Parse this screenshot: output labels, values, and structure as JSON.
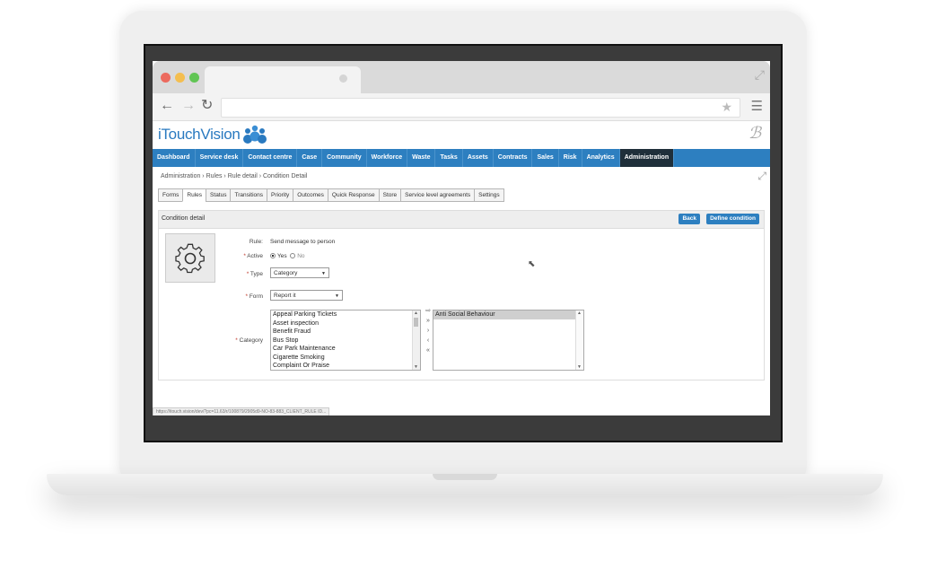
{
  "app": {
    "logo_text": "iTouchVision",
    "nav": [
      "Dashboard",
      "Service desk",
      "Contact centre",
      "Case",
      "Community",
      "Workforce",
      "Waste",
      "Tasks",
      "Assets",
      "Contracts",
      "Sales",
      "Risk",
      "Analytics",
      "Administration"
    ],
    "active_nav": "Administration"
  },
  "breadcrumb": "Administration  ›  Rules  ›  Rule detail  ›  Condition Detail",
  "subtabs": [
    "Forms",
    "Rules",
    "Status",
    "Transitions",
    "Priority",
    "Outcomes",
    "Quick Response",
    "Store",
    "Service level agreements",
    "Settings"
  ],
  "active_subtab": "Rules",
  "panel": {
    "title": "Condition detail",
    "back_label": "Back",
    "define_label": "Define condition"
  },
  "form": {
    "rule_label": "Rule:",
    "rule_value": "Send message to person",
    "active_label": "Active",
    "yes_label": "Yes",
    "no_label": "No",
    "type_label": "Type",
    "type_value": "Category",
    "form_label": "Form",
    "form_value": "Report it",
    "category_label": "Category",
    "available": [
      "Appeal Parking Tickets",
      "Asset inspection",
      "Benefit Fraud",
      "Bus Stop",
      "Car Park Maintenance",
      "Cigarette Smoking",
      "Complaint Or Praise"
    ],
    "selected": [
      "Anti Social Behaviour"
    ]
  },
  "status_url": "https://itouch.vision/dev/?pc=11.63/r/100879/2905d9-NO-83-883_CLIENT_RULE ID...",
  "icons": {
    "gear": "gear-icon",
    "add": "move-right-icon",
    "add_all": "move-all-right-icon",
    "remove": "move-left-icon",
    "remove_all": "move-all-left-icon"
  },
  "colors": {
    "nav_bg": "#2d7fc0",
    "nav_active": "#1f2f3a",
    "button": "#2d7fc0"
  }
}
